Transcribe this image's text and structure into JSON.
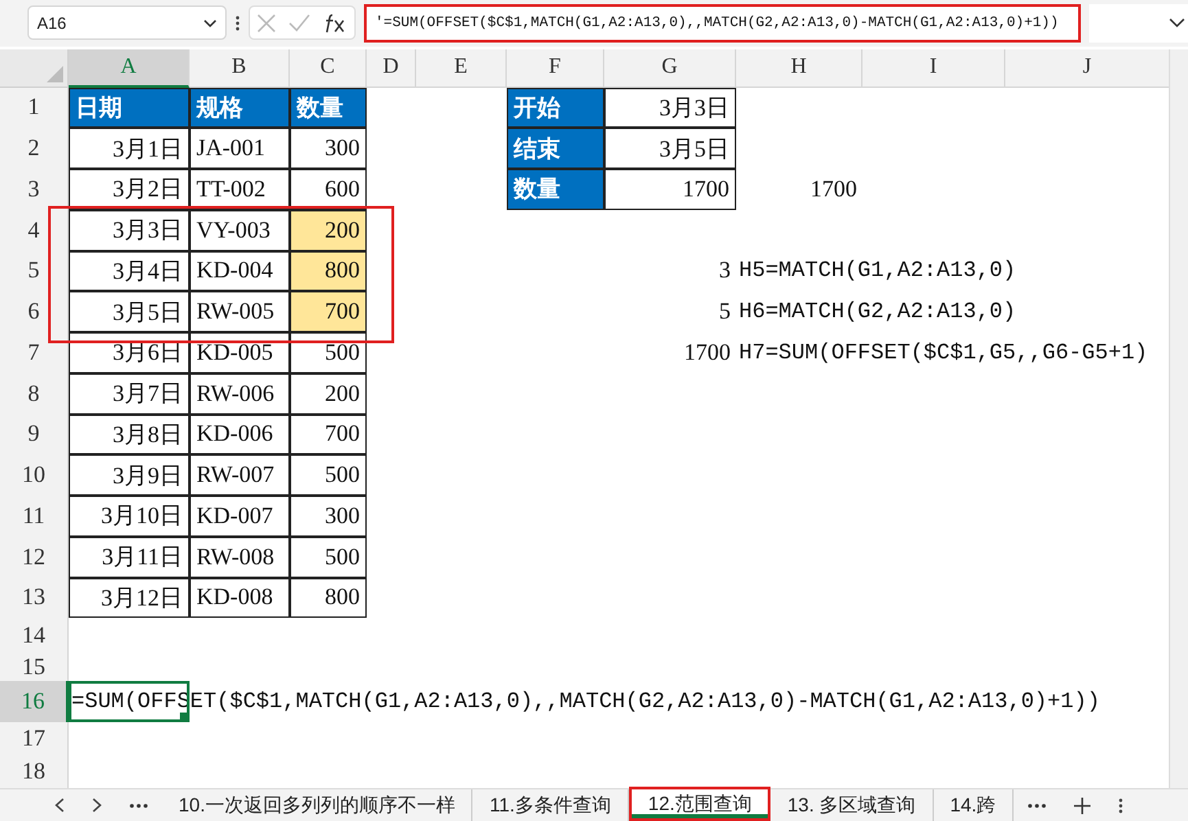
{
  "name_box": {
    "value": "A16"
  },
  "formula_bar": {
    "value": "'=SUM(OFFSET($C$1,MATCH(G1,A2:A13,0),,MATCH(G2,A2:A13,0)-MATCH(G1,A2:A13,0)+1))"
  },
  "columns": [
    {
      "label": "A",
      "selected": true
    },
    {
      "label": "B",
      "selected": false
    },
    {
      "label": "C",
      "selected": false
    },
    {
      "label": "D",
      "selected": false
    },
    {
      "label": "E",
      "selected": false
    },
    {
      "label": "F",
      "selected": false
    },
    {
      "label": "G",
      "selected": false
    },
    {
      "label": "H",
      "selected": false
    },
    {
      "label": "I",
      "selected": false
    },
    {
      "label": "J",
      "selected": false
    }
  ],
  "rows": [
    {
      "number": "1",
      "selected": false,
      "cells": [
        {
          "kind": "header",
          "text": "日期",
          "highlighted": false
        },
        {
          "kind": "header",
          "text": "规格",
          "highlighted": false
        },
        {
          "kind": "header",
          "text": "数量",
          "highlighted": false
        },
        null,
        null,
        {
          "kind": "header",
          "text": "开始",
          "highlighted": false
        },
        {
          "kind": "value",
          "text": "3月3日",
          "highlighted": false
        }
      ]
    },
    {
      "number": "2",
      "selected": false,
      "cells": [
        {
          "kind": "value",
          "text": "3月1日",
          "highlighted": false
        },
        {
          "kind": "text",
          "text": "JA-001",
          "highlighted": false
        },
        {
          "kind": "value",
          "text": "300",
          "highlighted": false
        },
        null,
        null,
        {
          "kind": "header",
          "text": "结束",
          "highlighted": false
        },
        {
          "kind": "value",
          "text": "3月5日",
          "highlighted": false
        }
      ]
    },
    {
      "number": "3",
      "selected": false,
      "cells": [
        {
          "kind": "value",
          "text": "3月2日",
          "highlighted": false
        },
        {
          "kind": "text",
          "text": "TT-002",
          "highlighted": false
        },
        {
          "kind": "value",
          "text": "600",
          "highlighted": false
        },
        null,
        null,
        {
          "kind": "header",
          "text": "数量",
          "highlighted": false
        },
        {
          "kind": "value",
          "text": "1700",
          "highlighted": false
        },
        {
          "kind": "plain",
          "text": "1700",
          "highlighted": false
        }
      ]
    },
    {
      "number": "4",
      "selected": false,
      "cells": [
        {
          "kind": "value",
          "text": "3月3日",
          "highlighted": false
        },
        {
          "kind": "text",
          "text": "VY-003",
          "highlighted": false
        },
        {
          "kind": "value",
          "text": "200",
          "highlighted": true
        }
      ]
    },
    {
      "number": "5",
      "selected": false,
      "cells": [
        {
          "kind": "value",
          "text": "3月4日",
          "highlighted": false
        },
        {
          "kind": "text",
          "text": "KD-004",
          "highlighted": false
        },
        {
          "kind": "value",
          "text": "800",
          "highlighted": true
        },
        null,
        null,
        null,
        {
          "kind": "plain",
          "text": "3",
          "highlighted": false
        },
        {
          "kind": "overflow",
          "text": "H5=MATCH(G1,A2:A13,0)",
          "highlighted": false
        }
      ]
    },
    {
      "number": "6",
      "selected": false,
      "cells": [
        {
          "kind": "value",
          "text": "3月5日",
          "highlighted": false
        },
        {
          "kind": "text",
          "text": "RW-005",
          "highlighted": false
        },
        {
          "kind": "value",
          "text": "700",
          "highlighted": true
        },
        null,
        null,
        null,
        {
          "kind": "plain",
          "text": "5",
          "highlighted": false
        },
        {
          "kind": "overflow",
          "text": "H6=MATCH(G2,A2:A13,0)",
          "highlighted": false
        }
      ]
    },
    {
      "number": "7",
      "selected": false,
      "cells": [
        {
          "kind": "value",
          "text": "3月6日",
          "highlighted": false
        },
        {
          "kind": "text",
          "text": "KD-005",
          "highlighted": false
        },
        {
          "kind": "value",
          "text": "500",
          "highlighted": false
        },
        null,
        null,
        null,
        {
          "kind": "plain",
          "text": "1700",
          "highlighted": false
        },
        {
          "kind": "overflow",
          "text": "H7=SUM(OFFSET($C$1,G5,,G6-G5+1)",
          "highlighted": false
        }
      ]
    },
    {
      "number": "8",
      "selected": false,
      "cells": [
        {
          "kind": "value",
          "text": "3月7日",
          "highlighted": false
        },
        {
          "kind": "text",
          "text": "RW-006",
          "highlighted": false
        },
        {
          "kind": "value",
          "text": "200",
          "highlighted": false
        }
      ]
    },
    {
      "number": "9",
      "selected": false,
      "cells": [
        {
          "kind": "value",
          "text": "3月8日",
          "highlighted": false
        },
        {
          "kind": "text",
          "text": "KD-006",
          "highlighted": false
        },
        {
          "kind": "value",
          "text": "700",
          "highlighted": false
        }
      ]
    },
    {
      "number": "10",
      "selected": false,
      "cells": [
        {
          "kind": "value",
          "text": "3月9日",
          "highlighted": false
        },
        {
          "kind": "text",
          "text": "RW-007",
          "highlighted": false
        },
        {
          "kind": "value",
          "text": "500",
          "highlighted": false
        }
      ]
    },
    {
      "number": "11",
      "selected": false,
      "cells": [
        {
          "kind": "value",
          "text": "3月10日",
          "highlighted": false
        },
        {
          "kind": "text",
          "text": "KD-007",
          "highlighted": false
        },
        {
          "kind": "value",
          "text": "300",
          "highlighted": false
        }
      ]
    },
    {
      "number": "12",
      "selected": false,
      "cells": [
        {
          "kind": "value",
          "text": "3月11日",
          "highlighted": false
        },
        {
          "kind": "text",
          "text": "RW-008",
          "highlighted": false
        },
        {
          "kind": "value",
          "text": "500",
          "highlighted": false
        }
      ]
    },
    {
      "number": "13",
      "selected": false,
      "cells": [
        {
          "kind": "value",
          "text": "3月12日",
          "highlighted": false
        },
        {
          "kind": "text",
          "text": "KD-008",
          "highlighted": false
        },
        {
          "kind": "value",
          "text": "800",
          "highlighted": false
        }
      ]
    },
    {
      "number": "14",
      "selected": false
    },
    {
      "number": "15",
      "selected": false
    },
    {
      "number": "16",
      "selected": true,
      "cells": [
        {
          "kind": "overflow",
          "text": "=SUM(OFFSET($C$1,MATCH(G1,A2:A13,0),,MATCH(G2,A2:A13,0)-MATCH(G1,A2:A13,0)+1))",
          "highlighted": false
        }
      ]
    },
    {
      "number": "17",
      "selected": false
    },
    {
      "number": "18",
      "selected": false
    }
  ],
  "sheet_tabs": [
    {
      "label": "10.一次返回多列列的顺序不一样",
      "selected": false
    },
    {
      "label": "11.多条件查询",
      "selected": false
    },
    {
      "label": "12.范围查询",
      "selected": true
    },
    {
      "label": "13. 多区域查询",
      "selected": false
    },
    {
      "label": "14.跨",
      "selected": false
    }
  ]
}
